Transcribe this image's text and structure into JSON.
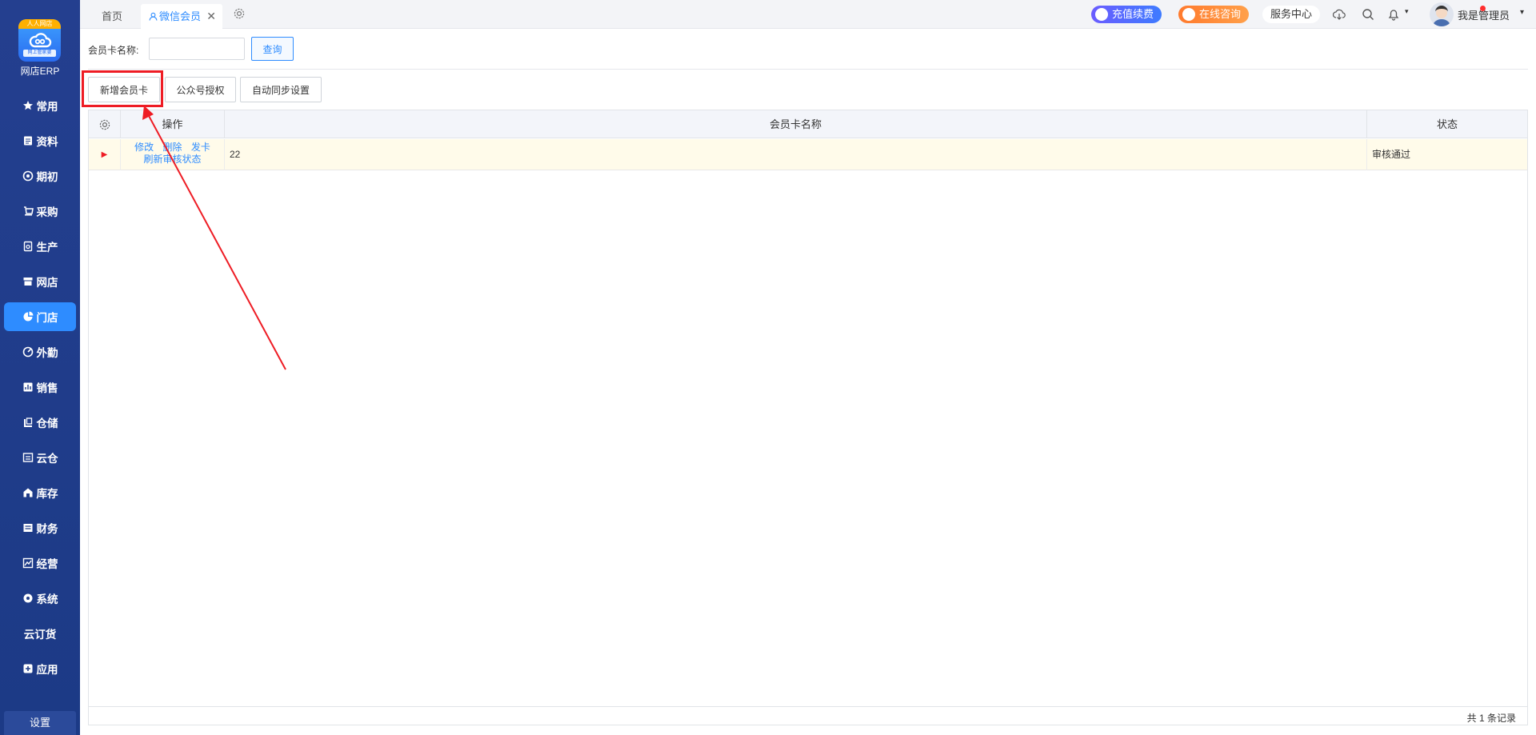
{
  "sidebar": {
    "logo_top": "人人网店",
    "logo_sub": "网上管家婆",
    "logo_label": "网店ERP",
    "items": [
      {
        "label": "常用",
        "icon": "star-icon"
      },
      {
        "label": "资料",
        "icon": "document-icon"
      },
      {
        "label": "期初",
        "icon": "target-icon"
      },
      {
        "label": "采购",
        "icon": "purchase-icon"
      },
      {
        "label": "生产",
        "icon": "production-icon"
      },
      {
        "label": "网店",
        "icon": "store-icon"
      },
      {
        "label": "门店",
        "icon": "pie-icon"
      },
      {
        "label": "外勤",
        "icon": "fieldwork-icon"
      },
      {
        "label": "销售",
        "icon": "sales-chart-icon"
      },
      {
        "label": "仓储",
        "icon": "warehouse-icon"
      },
      {
        "label": "云仓",
        "icon": "cloud-warehouse-icon"
      },
      {
        "label": "库存",
        "icon": "inventory-icon"
      },
      {
        "label": "财务",
        "icon": "finance-icon"
      },
      {
        "label": "经营",
        "icon": "operation-icon"
      },
      {
        "label": "系统",
        "icon": "system-gear-icon"
      },
      {
        "label": "云订货",
        "icon": ""
      },
      {
        "label": "应用",
        "icon": "plus-app-icon"
      }
    ],
    "active_index": 6,
    "settings_label": "设置"
  },
  "topbar": {
    "tabs": [
      {
        "label": "首页"
      },
      {
        "label": "微信会员",
        "icon": "user-icon",
        "closable": true
      }
    ],
    "close_glyph": "✕",
    "recharge_label": "充值续费",
    "consult_label": "在线咨询",
    "service_label": "服务中心",
    "admin_name": "我是管理员",
    "caret": "▾"
  },
  "search": {
    "label": "会员卡名称:",
    "value": "",
    "placeholder": "",
    "query_label": "查询"
  },
  "toolbar": {
    "new_card_label": "新增会员卡",
    "auth_label": "公众号授权",
    "sync_label": "自动同步设置"
  },
  "grid": {
    "columns": [
      "操作",
      "会员卡名称",
      "状态"
    ],
    "rows": [
      {
        "marker": "▶",
        "actions": [
          "修改",
          "删除",
          "发卡"
        ],
        "action_refresh": "刷新审核状态",
        "name": "22",
        "status": "审核通过"
      }
    ],
    "footer_total": "共 1 条记录"
  },
  "colors": {
    "sidebar_bg": "#1f3c88",
    "accent": "#2e8cff",
    "highlight": "#ee1c24",
    "row_highlight": "#fffbea"
  }
}
